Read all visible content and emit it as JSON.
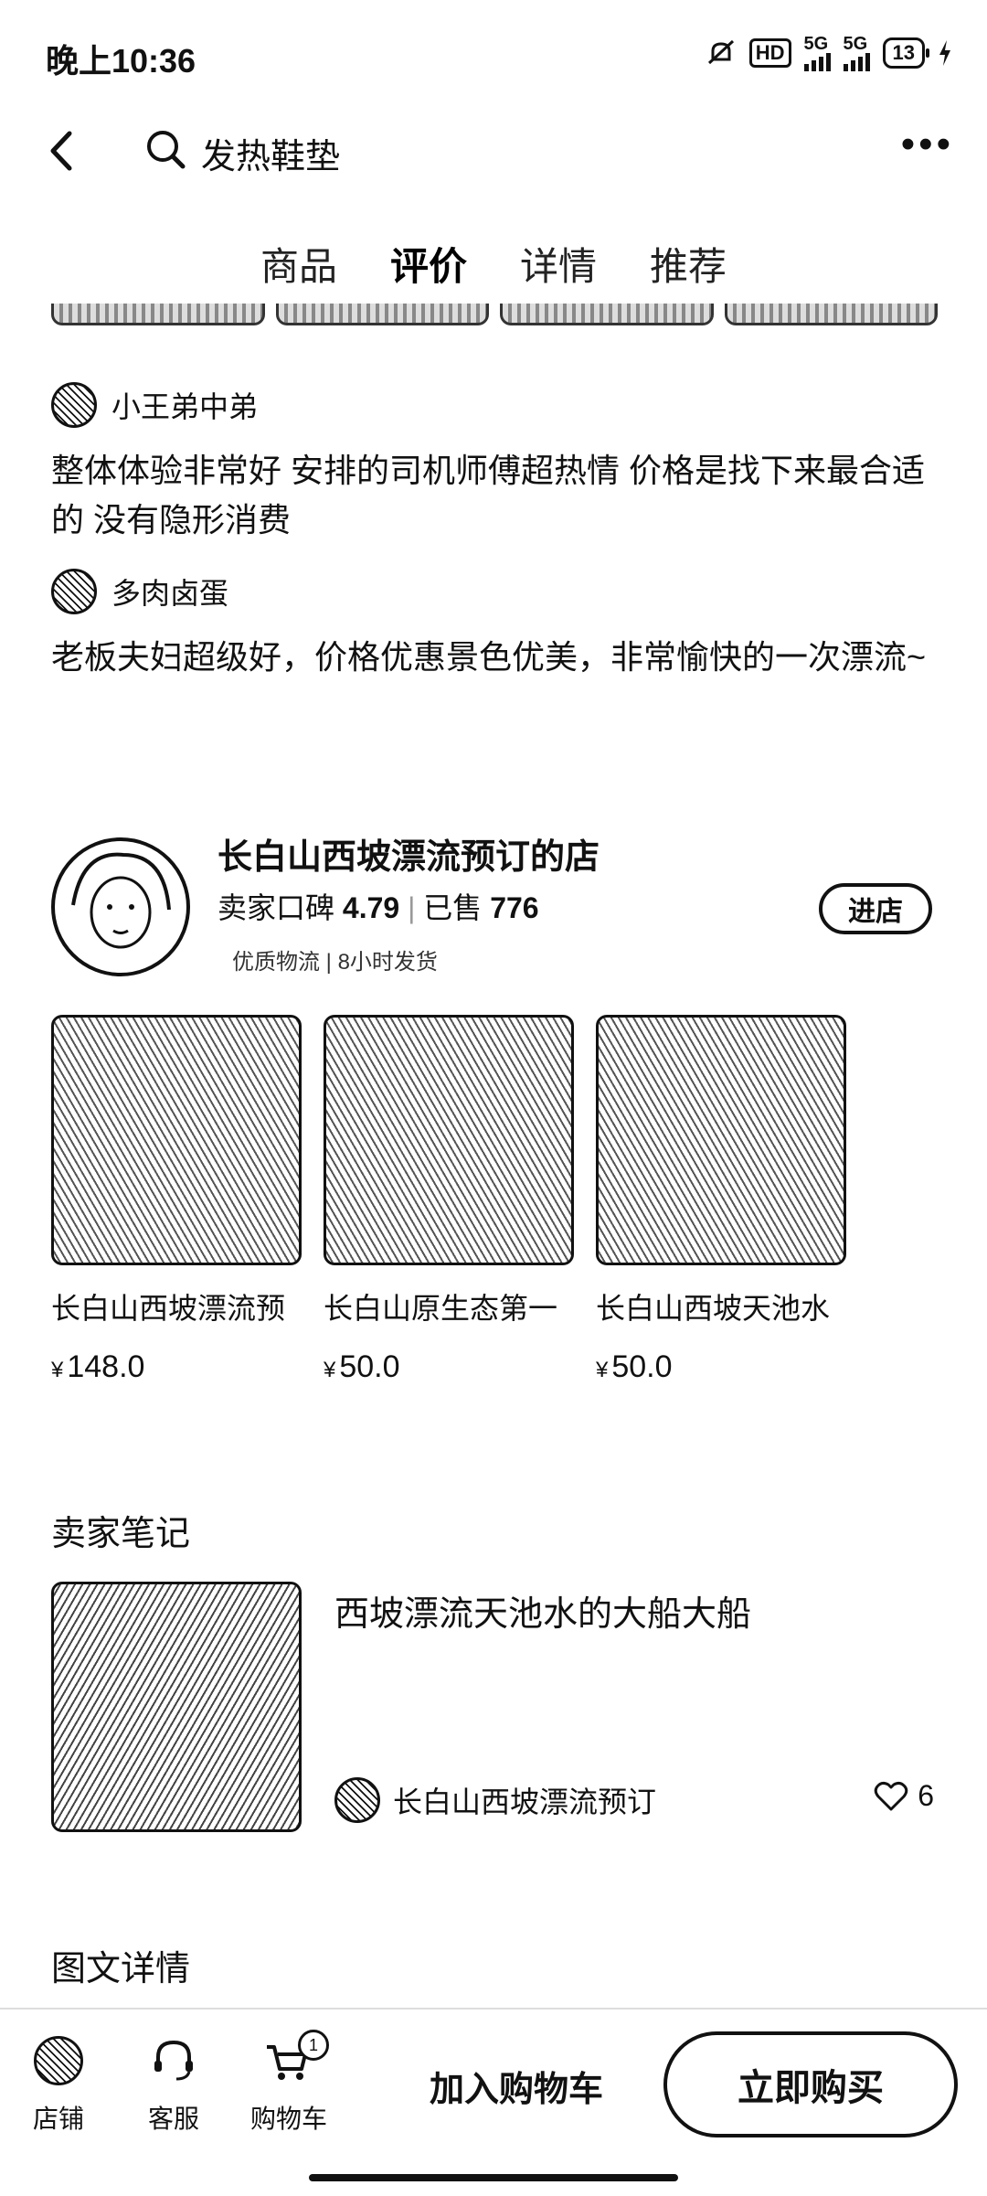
{
  "status_bar": {
    "time": "晚上10:36",
    "hd": "HD",
    "net1": "5G",
    "net2": "5G",
    "battery": "13"
  },
  "nav": {
    "search_text": "发热鞋垫"
  },
  "tabs": [
    {
      "label": "商品"
    },
    {
      "label": "评价",
      "active": true
    },
    {
      "label": "详情"
    },
    {
      "label": "推荐"
    }
  ],
  "reviews": [
    {
      "user": "小王弟中弟",
      "text": "整体体验非常好  安排的司机师傅超热情 价格是找下来最合适的  没有隐形消费"
    },
    {
      "user": "多肉卤蛋",
      "text": "老板夫妇超级好，价格优惠景色优美，非常愉快的一次漂流~"
    }
  ],
  "shop": {
    "name": "长白山西坡漂流预订的店",
    "rating_label": "卖家口碑",
    "rating": "4.79",
    "sold_label": "已售",
    "sold": "776",
    "tags": "优质物流 | 8小时发货",
    "enter_label": "进店"
  },
  "products": [
    {
      "title": "长白山西坡漂流预",
      "currency": "¥",
      "price": "148.0"
    },
    {
      "title": "长白山原生态第一",
      "currency": "¥",
      "price": "50.0"
    },
    {
      "title": "长白山西坡天池水",
      "currency": "¥",
      "price": "50.0"
    }
  ],
  "notes": {
    "section_title": "卖家笔记",
    "title": "西坡漂流天池水的大船大船",
    "author": "长白山西坡漂流预订",
    "likes": "6"
  },
  "detail_section_title": "图文详情",
  "bottom_bar": {
    "shop_label": "店铺",
    "service_label": "客服",
    "cart_label": "购物车",
    "cart_badge": "1",
    "add_cart_label": "加入购物车",
    "buy_label": "立即购买"
  }
}
